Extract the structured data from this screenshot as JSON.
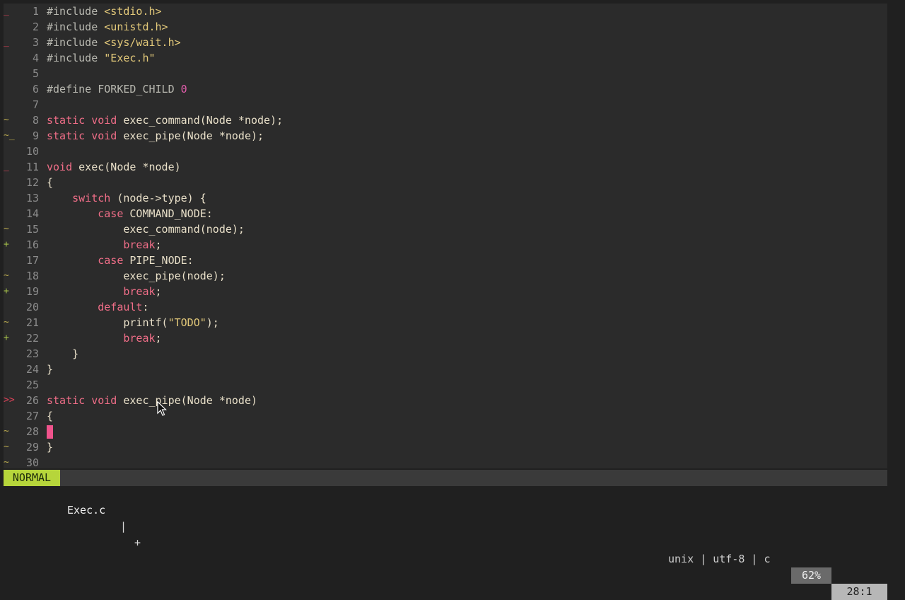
{
  "editor": {
    "lines": [
      {
        "n": "1",
        "sign": "_",
        "sign_type": "del"
      },
      {
        "n": "2",
        "sign": "",
        "sign_type": ""
      },
      {
        "n": "3",
        "sign": "_",
        "sign_type": "del"
      },
      {
        "n": "4",
        "sign": "",
        "sign_type": ""
      },
      {
        "n": "5",
        "sign": "",
        "sign_type": ""
      },
      {
        "n": "6",
        "sign": "",
        "sign_type": ""
      },
      {
        "n": "7",
        "sign": "",
        "sign_type": ""
      },
      {
        "n": "8",
        "sign": "~",
        "sign_type": "mod"
      },
      {
        "n": "9",
        "sign": "~_",
        "sign_type": "mod"
      },
      {
        "n": "10",
        "sign": "",
        "sign_type": ""
      },
      {
        "n": "11",
        "sign": "_",
        "sign_type": "del"
      },
      {
        "n": "12",
        "sign": "",
        "sign_type": ""
      },
      {
        "n": "13",
        "sign": "",
        "sign_type": ""
      },
      {
        "n": "14",
        "sign": "",
        "sign_type": ""
      },
      {
        "n": "15",
        "sign": "~",
        "sign_type": "mod"
      },
      {
        "n": "16",
        "sign": "+",
        "sign_type": "add"
      },
      {
        "n": "17",
        "sign": "",
        "sign_type": ""
      },
      {
        "n": "18",
        "sign": "~",
        "sign_type": "mod"
      },
      {
        "n": "19",
        "sign": "+",
        "sign_type": "add"
      },
      {
        "n": "20",
        "sign": "",
        "sign_type": ""
      },
      {
        "n": "21",
        "sign": "~",
        "sign_type": "mod"
      },
      {
        "n": "22",
        "sign": "+",
        "sign_type": "add"
      },
      {
        "n": "23",
        "sign": "",
        "sign_type": ""
      },
      {
        "n": "24",
        "sign": "",
        "sign_type": ""
      },
      {
        "n": "25",
        "sign": "",
        "sign_type": ""
      },
      {
        "n": "26",
        "sign": ">>",
        "sign_type": "arrow"
      },
      {
        "n": "27",
        "sign": "",
        "sign_type": ""
      },
      {
        "n": "28",
        "sign": "~",
        "sign_type": "mod"
      },
      {
        "n": "29",
        "sign": "~",
        "sign_type": "mod"
      },
      {
        "n": "30",
        "sign": "~",
        "sign_type": "mod"
      }
    ],
    "code": {
      "l1_a": "#include ",
      "l1_b": "<stdio.h>",
      "l2_a": "#include ",
      "l2_b": "<unistd.h>",
      "l3_a": "#include ",
      "l3_b": "<sys/wait.h>",
      "l4_a": "#include ",
      "l4_b": "\"Exec.h\"",
      "l6_a": "#define FORKED_CHILD ",
      "l6_b": "0",
      "l8_kw": "static void ",
      "l8_rest": "exec_command(Node *node);",
      "l9_kw": "static void ",
      "l9_rest": "exec_pipe(Node *node);",
      "l11_kw": "void ",
      "l11_rest": "exec(Node *node)",
      "l12": "{",
      "l13_ind": "    ",
      "l13_kw": "switch",
      "l13_rest": " (node->type) {",
      "l14_ind": "        ",
      "l14_kw": "case",
      "l14_rest": " COMMAND_NODE:",
      "l15_ind": "            ",
      "l15_rest": "exec_command(node);",
      "l16_ind": "            ",
      "l16_kw": "break",
      "l16_rest": ";",
      "l17_ind": "        ",
      "l17_kw": "case",
      "l17_rest": " PIPE_NODE:",
      "l18_ind": "            ",
      "l18_rest": "exec_pipe(node);",
      "l19_ind": "            ",
      "l19_kw": "break",
      "l19_rest": ";",
      "l20_ind": "        ",
      "l20_kw": "default",
      "l20_rest": ":",
      "l21_ind": "            ",
      "l21_a": "printf(",
      "l21_str": "\"TODO\"",
      "l21_b": ");",
      "l22_ind": "            ",
      "l22_kw": "break",
      "l22_rest": ";",
      "l23": "    }",
      "l24": "}",
      "l26_kw": "static void ",
      "l26_rest": "exec_pipe(Node *node)",
      "l27": "{",
      "l29": "}"
    }
  },
  "statusline": {
    "mode": "NORMAL",
    "filename": "Exec.c",
    "separator": "|",
    "modified": "+",
    "fileinfo": "unix | utf-8 | c",
    "percent": "62%",
    "position": "28:1"
  },
  "colors": {
    "mode_bg": "#b6d53b",
    "keyword": "#f06e88",
    "string": "#e3c97a",
    "number": "#e15dab",
    "cursor": "#f0538c",
    "sign_add": "#a6c24a",
    "sign_mod": "#b8a84e",
    "sign_del": "#e0435a"
  },
  "icons": {
    "mouse": "arrow-pointer-icon"
  }
}
